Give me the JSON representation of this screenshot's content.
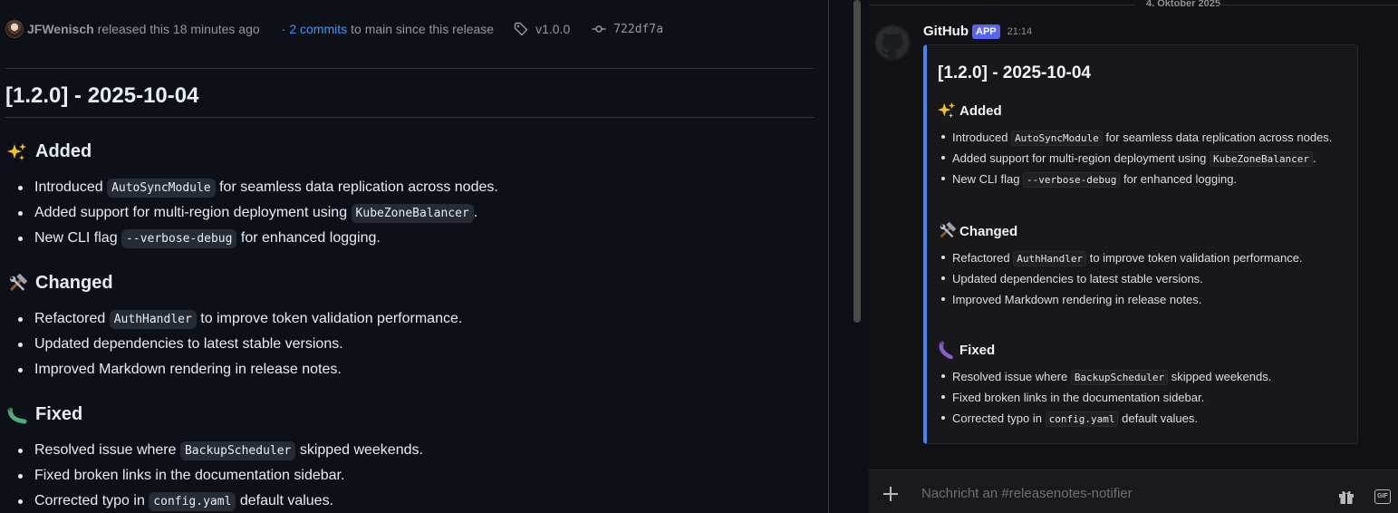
{
  "github": {
    "author": "JFWenisch",
    "released_text": "released this 18 minutes ago",
    "separator": "·",
    "commits_link": "2 commits",
    "commits_suffix": "to main since this release",
    "tag": "v1.0.0",
    "commit_sha": "722df7a",
    "title": "[1.2.0] - 2025-10-04",
    "sections": {
      "added": {
        "heading": "Added",
        "emoji": "sparkles-icon",
        "items": [
          {
            "pre": "Introduced",
            "code": "AutoSyncModule",
            "post": "for seamless data replication across nodes."
          },
          {
            "pre": "Added support for multi-region deployment using",
            "code": "KubeZoneBalancer",
            "post": "."
          },
          {
            "pre": "New CLI flag",
            "code": "--verbose-debug",
            "post": "for enhanced logging."
          }
        ]
      },
      "changed": {
        "heading": "Changed",
        "emoji": "hammer-wrench-icon",
        "items": [
          {
            "pre": "Refactored",
            "code": "AuthHandler",
            "post": "to improve token validation performance."
          },
          {
            "text": "Updated dependencies to latest stable versions."
          },
          {
            "text": "Improved Markdown rendering in release notes."
          }
        ]
      },
      "fixed": {
        "heading": "Fixed",
        "emoji": "bug-icon",
        "items": [
          {
            "pre": "Resolved issue where",
            "code": "BackupScheduler",
            "post": "skipped weekends."
          },
          {
            "text": "Fixed broken links in the documentation sidebar."
          },
          {
            "pre": "Corrected typo in",
            "code": "config.yaml",
            "post": "default values."
          }
        ]
      }
    }
  },
  "discord": {
    "date_divider": "4. Oktober 2025",
    "username": "GitHub",
    "badge": "APP",
    "time": "21:14",
    "composer_placeholder": "Nachricht an #releasenotes-notifier",
    "gif_label": "GIF",
    "embed_accent": "#3f87f5"
  },
  "colors": {
    "link": "#4493f8",
    "app_badge": "#5865f2"
  }
}
